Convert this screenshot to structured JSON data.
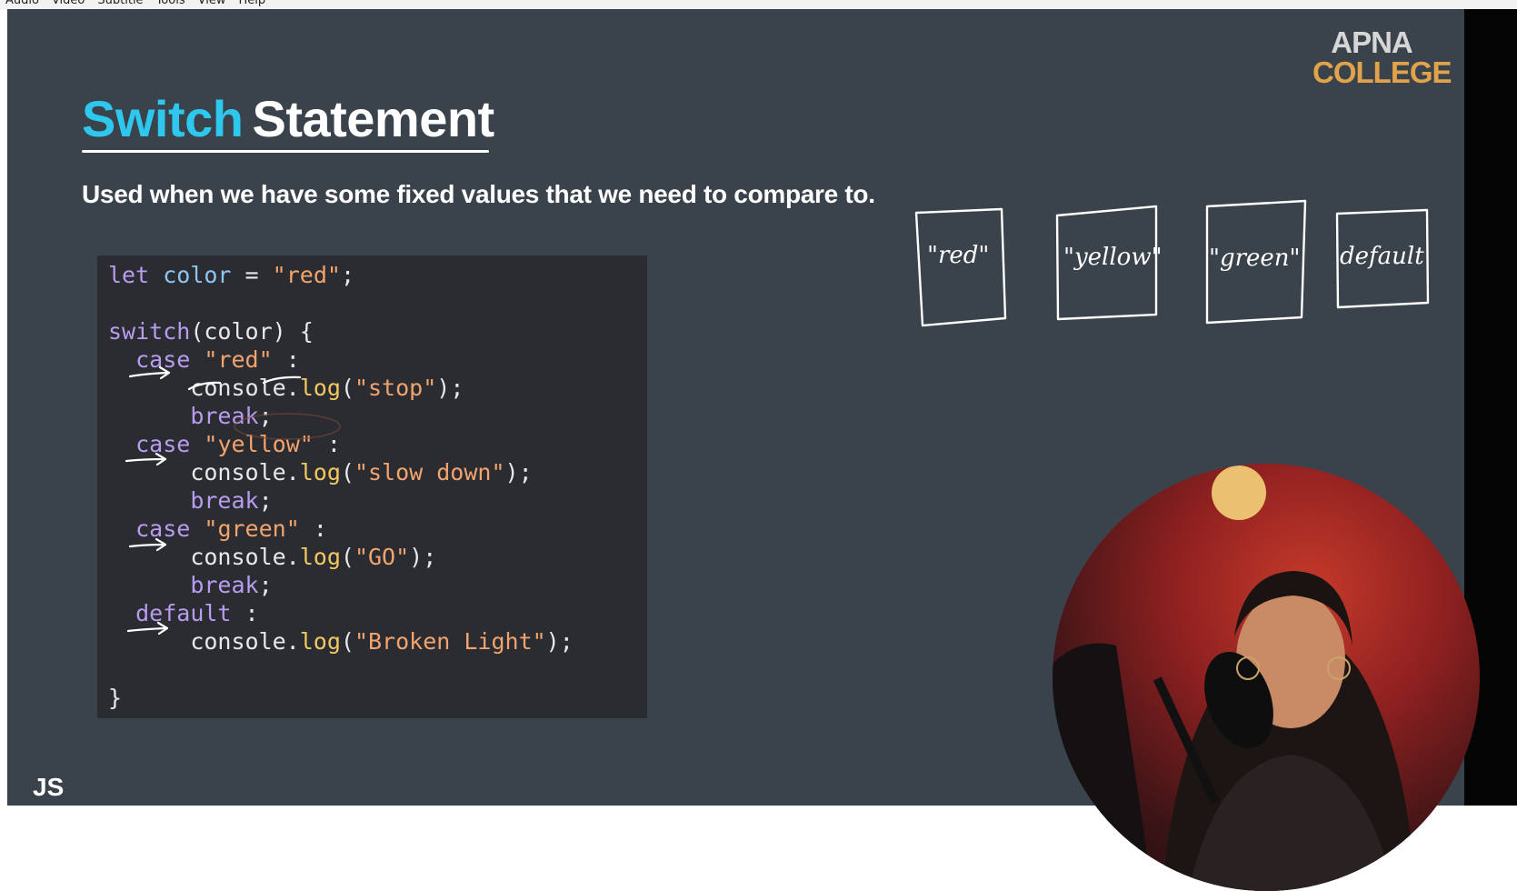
{
  "menubar": {
    "items": [
      "Audio",
      "Video",
      "Subtitle",
      "Tools",
      "View",
      "Help"
    ]
  },
  "logo": {
    "line1": "APNA",
    "line2": "COLLEGE"
  },
  "slide": {
    "title_highlight": "Switch",
    "title_rest": "Statement",
    "subtitle": "Used when we have some fixed values that we need to compare to.",
    "footer_label": "JS"
  },
  "code": {
    "lines": [
      "let color = \"red\";",
      "",
      "switch(color) {",
      "  case \"red\" :",
      "      console.log(\"stop\");",
      "      break;",
      "  case \"yellow\" :",
      "      console.log(\"slow down\");",
      "      break;",
      "  case \"green\" :",
      "      console.log(\"GO\");",
      "      break;",
      "  default :",
      "      console.log(\"Broken Light\");",
      "",
      "}"
    ]
  },
  "handwritten_boxes": [
    "\"red\"",
    "\"yellow\"",
    "\"green\"",
    "default"
  ],
  "colors": {
    "background": "#3a424b",
    "title_accent": "#2ec8ee",
    "code_bg": "#2b2c31",
    "keyword": "#b79cf0",
    "string": "#f3a46d",
    "function": "#f2c861",
    "logo_accent": "#e0a24a"
  },
  "icons": [
    "apna-college-logo",
    "presenter-camera"
  ]
}
